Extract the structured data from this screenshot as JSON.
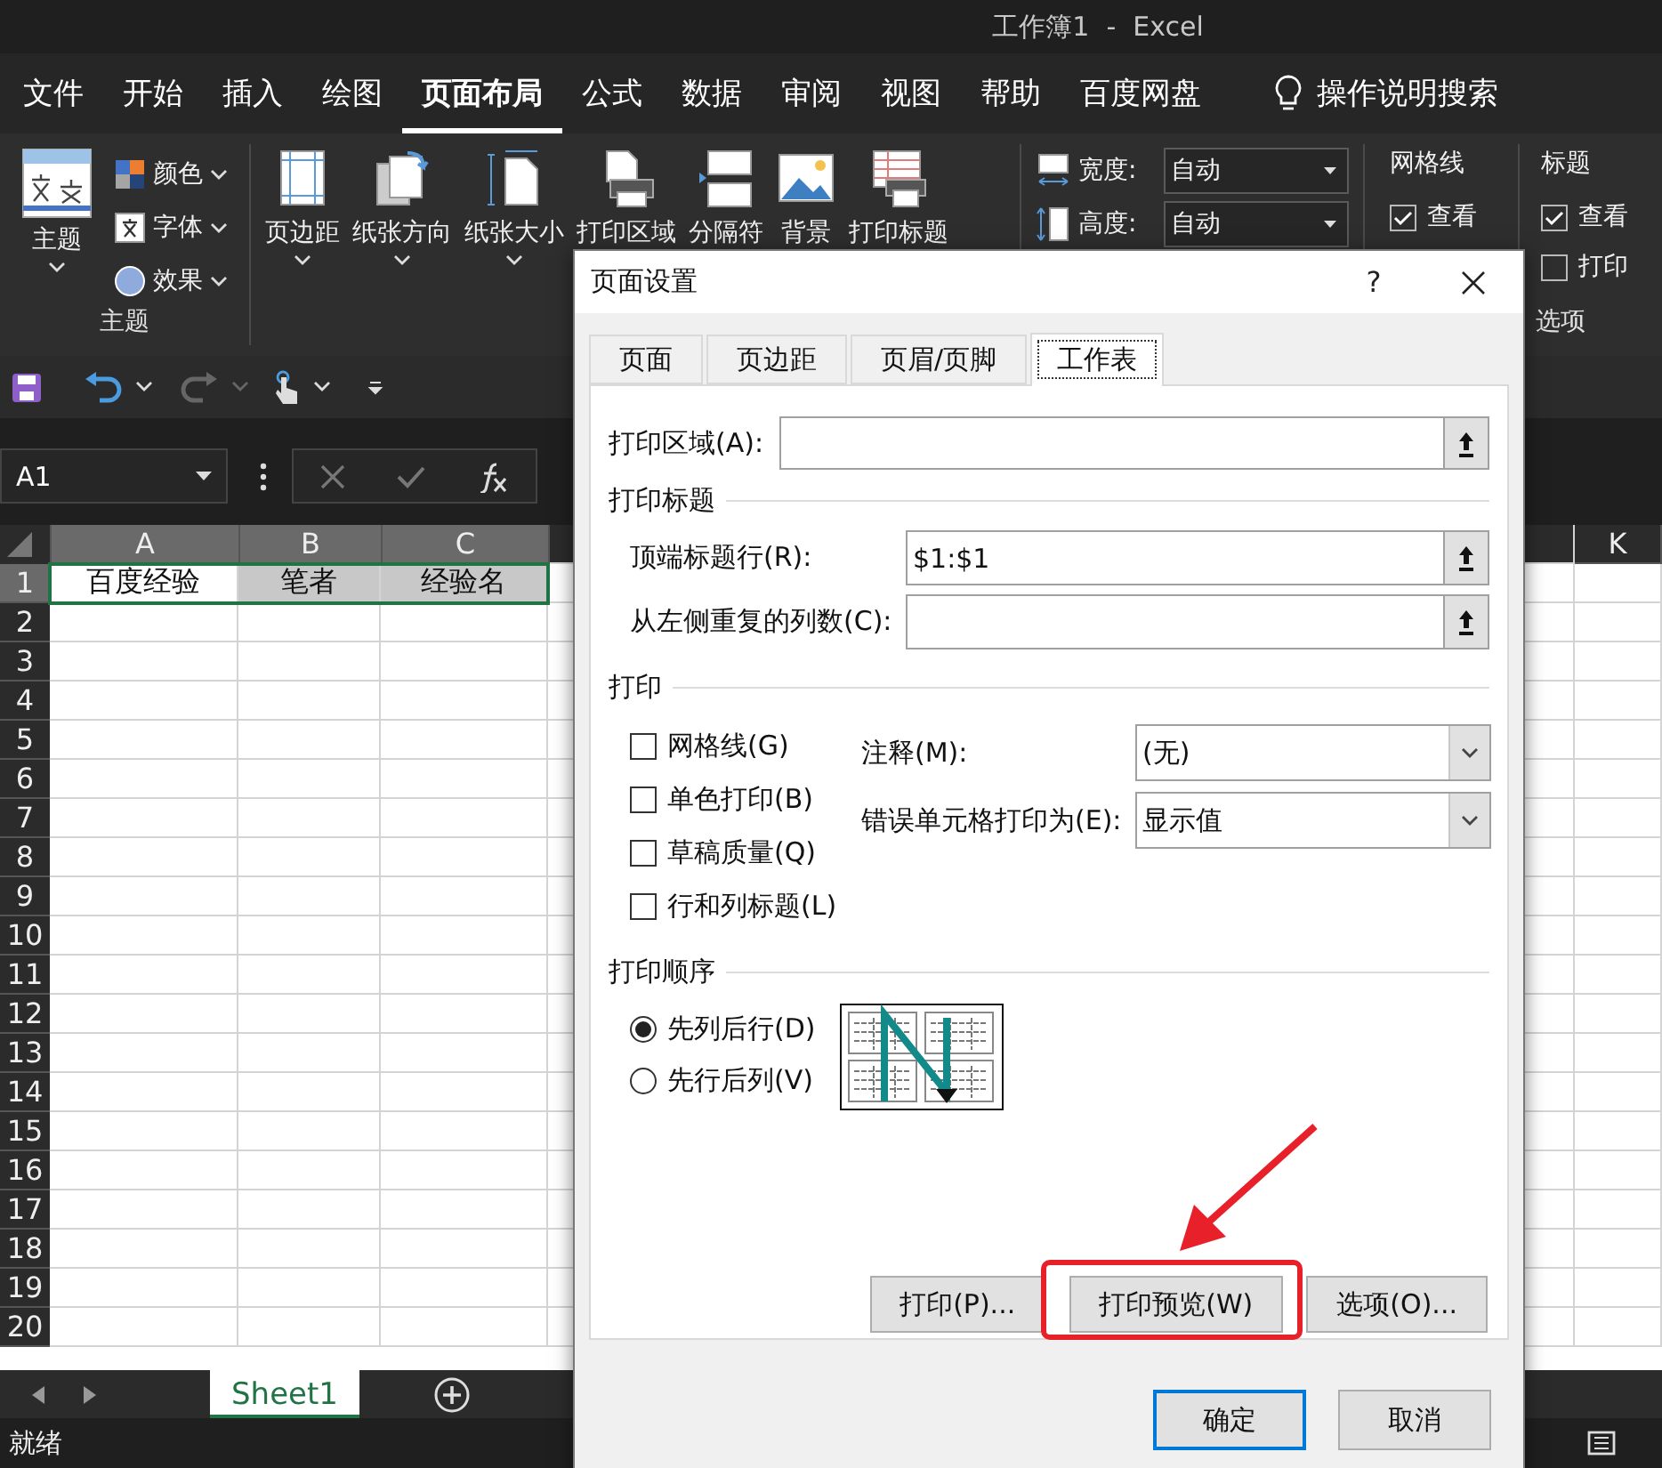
{
  "window": {
    "title": "工作簿1  -  Excel"
  },
  "menu_tabs": [
    {
      "label": "文件",
      "selected": false
    },
    {
      "label": "开始",
      "selected": false
    },
    {
      "label": "插入",
      "selected": false
    },
    {
      "label": "绘图",
      "selected": false
    },
    {
      "label": "页面布局",
      "selected": true
    },
    {
      "label": "公式",
      "selected": false
    },
    {
      "label": "数据",
      "selected": false
    },
    {
      "label": "审阅",
      "selected": false
    },
    {
      "label": "视图",
      "selected": false
    },
    {
      "label": "帮助",
      "selected": false
    },
    {
      "label": "百度网盘",
      "selected": false
    }
  ],
  "tell_me": {
    "label": "操作说明搜索"
  },
  "theme_group": {
    "label": "主题",
    "big_button": "主题",
    "items": [
      {
        "label": "颜色"
      },
      {
        "label": "字体"
      },
      {
        "label": "效果"
      }
    ]
  },
  "page_setup_buttons": [
    {
      "label": "页边距",
      "dropdown": true
    },
    {
      "label": "纸张方向",
      "dropdown": true
    },
    {
      "label": "纸张大小",
      "dropdown": true
    },
    {
      "label": "打印区域",
      "dropdown": false
    },
    {
      "label": "分隔符",
      "dropdown": false
    },
    {
      "label": "背景",
      "dropdown": false
    },
    {
      "label": "打印标题",
      "dropdown": false
    }
  ],
  "scale": [
    {
      "label": "宽度:",
      "value": "自动"
    },
    {
      "label": "高度:",
      "value": "自动"
    }
  ],
  "gridlines": {
    "title": "网格线",
    "options": [
      {
        "label": "查看",
        "checked": true
      }
    ]
  },
  "headings": {
    "title": "标题",
    "options": [
      {
        "label": "查看",
        "checked": true
      },
      {
        "label": "打印",
        "checked": false
      }
    ]
  },
  "sheet_options_label": "选项",
  "name_box": "A1",
  "columns": [
    {
      "label": "A",
      "selected": true
    },
    {
      "label": "B",
      "selected": true
    },
    {
      "label": "C",
      "selected": true
    }
  ],
  "right_columns": [
    {
      "label": "K",
      "selected": false
    }
  ],
  "rows": [
    {
      "label": "1",
      "selected": true,
      "cells": [
        {
          "text": "百度经验",
          "active": true
        },
        {
          "text": "笔者",
          "active": false
        },
        {
          "text": "经验名",
          "active": false
        }
      ]
    },
    {
      "label": "2",
      "selected": false
    },
    {
      "label": "3",
      "selected": false
    },
    {
      "label": "4",
      "selected": false
    },
    {
      "label": "5",
      "selected": false
    },
    {
      "label": "6",
      "selected": false
    },
    {
      "label": "7",
      "selected": false
    },
    {
      "label": "8",
      "selected": false
    },
    {
      "label": "9",
      "selected": false
    },
    {
      "label": "10",
      "selected": false
    },
    {
      "label": "11",
      "selected": false
    },
    {
      "label": "12",
      "selected": false
    },
    {
      "label": "13",
      "selected": false
    },
    {
      "label": "14",
      "selected": false
    },
    {
      "label": "15",
      "selected": false
    },
    {
      "label": "16",
      "selected": false
    },
    {
      "label": "17",
      "selected": false
    },
    {
      "label": "18",
      "selected": false
    },
    {
      "label": "19",
      "selected": false
    },
    {
      "label": "20",
      "selected": false
    }
  ],
  "sheet_tabs": [
    {
      "label": "Sheet1",
      "selected": true
    }
  ],
  "status": "就绪",
  "dialog": {
    "title": "页面设置",
    "help": "?",
    "tabs": [
      {
        "label": "页面",
        "selected": false
      },
      {
        "label": "页边距",
        "selected": false
      },
      {
        "label": "页眉/页脚",
        "selected": false
      },
      {
        "label": "工作表",
        "selected": true
      }
    ],
    "print_area": {
      "label": "打印区域(A):"
    },
    "print_titles": {
      "title": "打印标题",
      "fields": [
        {
          "label": "顶端标题行(R):",
          "value": "$1:$1"
        },
        {
          "label": "从左侧重复的列数(C):"
        }
      ]
    },
    "print": {
      "title": "打印",
      "checkboxes": [
        {
          "label": "网格线(G)",
          "checked": false
        },
        {
          "label": "单色打印(B)",
          "checked": false
        },
        {
          "label": "草稿质量(Q)",
          "checked": false
        },
        {
          "label": "行和列标题(L)",
          "checked": false
        }
      ],
      "selects": [
        {
          "label": "注释(M):",
          "value": "(无)"
        },
        {
          "label": "错误单元格打印为(E):",
          "value": "显示值"
        }
      ]
    },
    "page_order": {
      "title": "打印顺序",
      "options": [
        {
          "label": "先列后行(D)",
          "selected": true
        },
        {
          "label": "先行后列(V)",
          "selected": false
        }
      ]
    },
    "buttons": [
      {
        "label": "打印(P)...",
        "highlighted": false
      },
      {
        "label": "打印预览(W)",
        "highlighted": true
      },
      {
        "label": "选项(O)...",
        "highlighted": false
      }
    ],
    "footer_buttons": [
      {
        "label": "确定",
        "default": true
      },
      {
        "label": "取消",
        "default": false
      }
    ]
  }
}
